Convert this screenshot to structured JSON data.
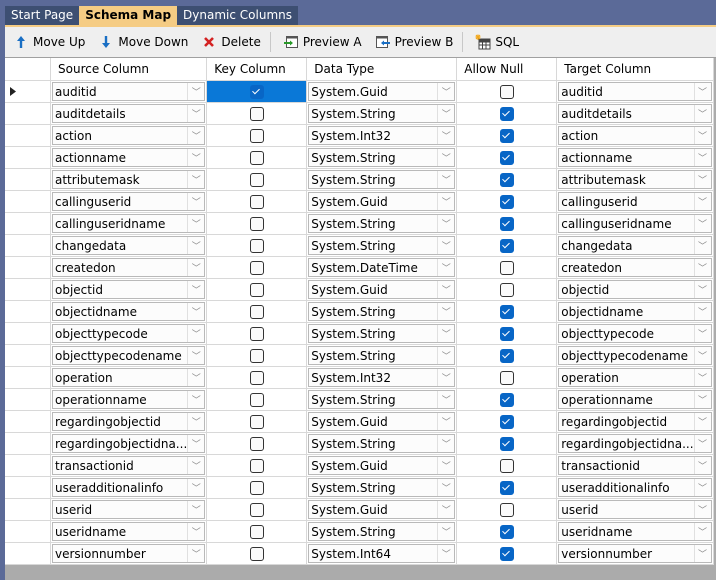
{
  "tabs": [
    {
      "label": "Start Page",
      "active": false
    },
    {
      "label": "Schema Map",
      "active": true
    },
    {
      "label": "Dynamic Columns",
      "active": false
    }
  ],
  "toolbar": {
    "move_up": "Move Up",
    "move_down": "Move Down",
    "delete": "Delete",
    "preview_a": "Preview A",
    "preview_b": "Preview B",
    "sql": "SQL"
  },
  "grid": {
    "headers": {
      "source": "Source Column",
      "key": "Key Column",
      "type": "Data Type",
      "allow_null": "Allow Null",
      "target": "Target Column"
    },
    "current_row": 0,
    "rows": [
      {
        "source": "auditid",
        "key": true,
        "type": "System.Guid",
        "null": false,
        "target": "auditid"
      },
      {
        "source": "auditdetails",
        "key": false,
        "type": "System.String",
        "null": true,
        "target": "auditdetails"
      },
      {
        "source": "action",
        "key": false,
        "type": "System.Int32",
        "null": true,
        "target": "action"
      },
      {
        "source": "actionname",
        "key": false,
        "type": "System.String",
        "null": true,
        "target": "actionname"
      },
      {
        "source": "attributemask",
        "key": false,
        "type": "System.String",
        "null": true,
        "target": "attributemask"
      },
      {
        "source": "callinguserid",
        "key": false,
        "type": "System.Guid",
        "null": true,
        "target": "callinguserid"
      },
      {
        "source": "callinguseridname",
        "key": false,
        "type": "System.String",
        "null": true,
        "target": "callinguseridname"
      },
      {
        "source": "changedata",
        "key": false,
        "type": "System.String",
        "null": true,
        "target": "changedata"
      },
      {
        "source": "createdon",
        "key": false,
        "type": "System.DateTime",
        "null": false,
        "target": "createdon"
      },
      {
        "source": "objectid",
        "key": false,
        "type": "System.Guid",
        "null": false,
        "target": "objectid"
      },
      {
        "source": "objectidname",
        "key": false,
        "type": "System.String",
        "null": true,
        "target": "objectidname"
      },
      {
        "source": "objecttypecode",
        "key": false,
        "type": "System.String",
        "null": true,
        "target": "objecttypecode"
      },
      {
        "source": "objecttypecodename",
        "key": false,
        "type": "System.String",
        "null": true,
        "target": "objecttypecodename"
      },
      {
        "source": "operation",
        "key": false,
        "type": "System.Int32",
        "null": false,
        "target": "operation"
      },
      {
        "source": "operationname",
        "key": false,
        "type": "System.String",
        "null": true,
        "target": "operationname"
      },
      {
        "source": "regardingobjectid",
        "key": false,
        "type": "System.Guid",
        "null": true,
        "target": "regardingobjectid"
      },
      {
        "source": "regardingobjectidna...",
        "key": false,
        "type": "System.String",
        "null": true,
        "target": "regardingobjectidna..."
      },
      {
        "source": "transactionid",
        "key": false,
        "type": "System.Guid",
        "null": false,
        "target": "transactionid"
      },
      {
        "source": "useradditionalinfo",
        "key": false,
        "type": "System.String",
        "null": true,
        "target": "useradditionalinfo"
      },
      {
        "source": "userid",
        "key": false,
        "type": "System.Guid",
        "null": false,
        "target": "userid"
      },
      {
        "source": "useridname",
        "key": false,
        "type": "System.String",
        "null": true,
        "target": "useridname"
      },
      {
        "source": "versionnumber",
        "key": false,
        "type": "System.Int64",
        "null": true,
        "target": "versionnumber"
      }
    ]
  }
}
